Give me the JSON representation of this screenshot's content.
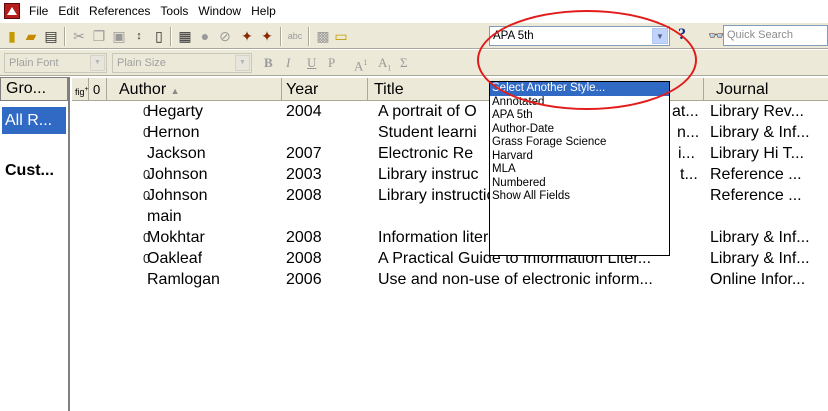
{
  "menu": [
    "File",
    "Edit",
    "References",
    "Tools",
    "Window",
    "Help"
  ],
  "toolbar": {
    "style_value": "APA 5th",
    "quick_search_placeholder": "Quick Search",
    "help_label": "?"
  },
  "format_bar": {
    "font": "Plain Font",
    "size": "Plain Size",
    "bold": "B",
    "italic": "I",
    "underline": "U",
    "plain": "P",
    "superscript": "A",
    "subscript": "A",
    "symbol": "Σ"
  },
  "groups": {
    "header": "Gro...",
    "all": "All R...",
    "custom": "Cust..."
  },
  "columns": {
    "fig": "fig",
    "author": "Author",
    "author_sort": "▲",
    "year": "Year",
    "title": "Title",
    "journal": "Journal"
  },
  "style_popup": {
    "options": [
      "Select Another Style...",
      "Annotated",
      "APA 5th",
      "Author-Date",
      "Grass Forage Science",
      "Harvard",
      "MLA",
      "Numbered",
      "Show All Fields"
    ],
    "highlighted": "Select Another Style..."
  },
  "references": [
    {
      "clip": "0",
      "author": "Hegarty",
      "year": "2004",
      "title": "A portrait of O",
      "title_tail": "at...",
      "journal": "Library Rev..."
    },
    {
      "clip": "0",
      "author": "Hernon",
      "year": "",
      "title": "Student learni",
      "title_tail": "n...",
      "journal": "Library & Inf..."
    },
    {
      "clip": "",
      "author": "Jackson",
      "year": "2007",
      "title": "Electronic Re",
      "title_tail": "i...",
      "journal": "Library Hi T..."
    },
    {
      "clip": "0",
      "author": "Johnson",
      "year": "2003",
      "title": "Library instruc",
      "title_tail": "t...",
      "journal": "Reference ..."
    },
    {
      "clip": "0",
      "author": "Johnson",
      "year": "2008",
      "title": "Library instruction and information lit...",
      "title_tail": "",
      "journal": "Reference ..."
    },
    {
      "clip": "",
      "author": "main",
      "year": "",
      "title": "",
      "title_tail": "",
      "journal": ""
    },
    {
      "clip": "0",
      "author": "Mokhtar",
      "year": "2008",
      "title": "Information literacy education: Applic...",
      "title_tail": "",
      "journal": "Library & Inf..."
    },
    {
      "clip": "0",
      "author": "Oakleaf",
      "year": "2008",
      "title": "A Practical Guide to Information Liter...",
      "title_tail": "",
      "journal": "Library & Inf..."
    },
    {
      "clip": "",
      "author": "Ramlogan",
      "year": "2006",
      "title": "Use and non-use of electronic inform...",
      "title_tail": "",
      "journal": "Online Infor..."
    }
  ],
  "colors": {
    "selection": "#316ac5",
    "annotation_ellipse": "#e21b1b",
    "toolbar_bg": "#ece9d8"
  }
}
